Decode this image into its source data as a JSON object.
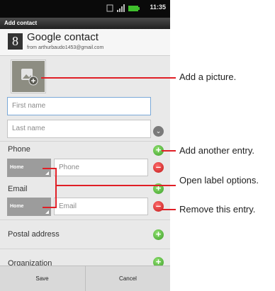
{
  "status": {
    "time": "11:35"
  },
  "appbar": {
    "title": "Add contact"
  },
  "account": {
    "name": "Google contact",
    "email": "from arthurbaudo1453@gmail.com",
    "logo_letter": "8"
  },
  "photo": {
    "icon": "add-photo-icon"
  },
  "name_fields": {
    "first_placeholder": "First name",
    "last_placeholder": "Last name"
  },
  "sections": {
    "phone": {
      "title": "Phone",
      "label": "Home",
      "placeholder": "Phone"
    },
    "email": {
      "title": "Email",
      "label": "Home",
      "placeholder": "Email"
    },
    "postal": {
      "title": "Postal address"
    },
    "organization": {
      "title": "Organization"
    }
  },
  "footer": {
    "save": "Save",
    "cancel": "Cancel"
  },
  "callouts": {
    "picture": "Add a picture.",
    "add_entry": "Add another entry.",
    "label_options": "Open label options.",
    "remove_entry": "Remove this entry."
  },
  "colors": {
    "callout": "#e01f26",
    "add": "#3e9f2a",
    "remove": "#c11a1a"
  }
}
